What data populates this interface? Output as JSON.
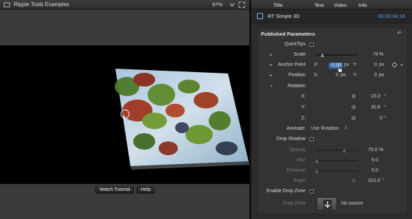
{
  "viewer": {
    "title": "Ripple Tools Examples",
    "zoom": "97%",
    "buttons": {
      "watch_tutorial": "Watch Tutorial",
      "help": "Help"
    }
  },
  "inspector": {
    "tabs": [
      "Title",
      "Text",
      "Video",
      "Info"
    ],
    "effect_name": "RT Simple 3D",
    "timecode": "00:00:04;16",
    "section_title": "Published Parameters",
    "params": {
      "quicktips": "QuickTips",
      "scale": {
        "label": "Scale",
        "value": "76",
        "unit": "%"
      },
      "anchor_point": {
        "label": "Anchor Point",
        "x_label": "X:",
        "x_value": "-0.00",
        "x_unit": "px",
        "y_label": "Y:",
        "y_value": "0",
        "y_unit": "px"
      },
      "position": {
        "label": "Position",
        "x_label": "X:",
        "x_value": "0",
        "x_unit": "px",
        "y_label": "Y:",
        "y_value": "0",
        "y_unit": "px"
      },
      "rotation": {
        "label": "Rotation",
        "x_label": "X:",
        "x_value": "-23.3",
        "y_label": "Y:",
        "y_value": "30.8",
        "z_label": "Z:",
        "z_value": "0",
        "unit": "°"
      },
      "animate": {
        "label": "Animate:",
        "value": "Use Rotation"
      },
      "drop_shadow": "Drop Shadow",
      "opacity": {
        "label": "Opacity",
        "value": "75.0",
        "unit": "%"
      },
      "blur": {
        "label": "Blur",
        "value": "5.0"
      },
      "distance": {
        "label": "Distance",
        "value": "5.0"
      },
      "angle": {
        "label": "Angle",
        "value": "315.0",
        "unit": "°"
      },
      "enable_drop_zone": "Enable Drop Zone",
      "drop_zone": {
        "label": "Drop Zone",
        "value": "No source"
      }
    }
  }
}
